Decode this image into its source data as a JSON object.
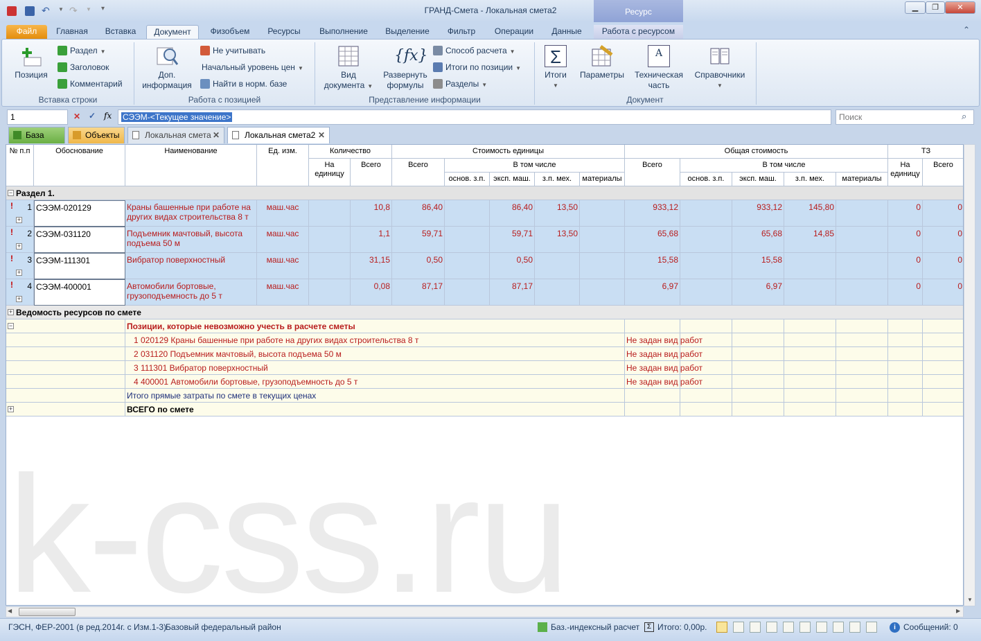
{
  "window": {
    "title": "ГРАНД-Смета - Локальная смета2",
    "context_tab": "Ресурс",
    "buttons": {
      "minimize": "▁",
      "restore": "❐",
      "close": "✕"
    }
  },
  "ribbon_tabs": [
    "Файл",
    "Главная",
    "Вставка",
    "Документ",
    "Физобъем",
    "Ресурсы",
    "Выполнение",
    "Выделение",
    "Фильтр",
    "Операции",
    "Данные",
    "Работа с ресурсом"
  ],
  "ribbon": {
    "groups": {
      "insert_row": "Вставка строки",
      "position_work": "Работа с позицией",
      "info_view": "Представление информации",
      "document": "Документ"
    },
    "insert_row": {
      "position": "Позиция",
      "section": "Раздел",
      "heading": "Заголовок",
      "comment": "Комментарий"
    },
    "position_work": {
      "extra_info_1": "Доп.",
      "extra_info_2": "информация",
      "ignore": "Не учитывать",
      "initial_price_level": "Начальный уровень цен",
      "find_in_base": "Найти в норм. базе"
    },
    "info_view": {
      "view_1": "Вид",
      "view_2": "документа",
      "formulas_1": "Развернуть",
      "formulas_2": "формулы",
      "calc_method": "Способ расчета",
      "position_totals": "Итоги по позиции",
      "sections": "Разделы"
    },
    "document": {
      "totals": "Итоги",
      "parameters": "Параметры",
      "tech_1": "Техническая",
      "tech_2": "часть",
      "refs": "Справочники"
    }
  },
  "formula_bar": {
    "cell_ref": "1",
    "value": "СЭЭМ-<Текущее значение>",
    "search_placeholder": "Поиск"
  },
  "doc_tabs": [
    "База",
    "Объекты",
    "Локальная смета",
    "Локальная смета2"
  ],
  "grid": {
    "headers": {
      "num": "№ п.п",
      "basis": "Обоснование",
      "name": "Наименование",
      "unit": "Ед. изм.",
      "qty": "Количество",
      "qty_per_unit": "На единицу",
      "qty_total": "Всего",
      "unit_cost": "Стоимость единицы",
      "unit_cost_total": "Всего",
      "incl": "В том числе",
      "base_wage": "основ. з.п.",
      "mach_exp": "эксп. маш.",
      "mach_wage": "з.п. мех.",
      "materials": "материалы",
      "total_cost": "Общая стоимость",
      "total_cost_total": "Всего",
      "incl2": "В том числе",
      "base_wage2": "основ. з.п.",
      "mach_exp2": "эксп. маш.",
      "mach_wage2": "з.п. мех.",
      "materials2": "материалы",
      "tz": "ТЗ",
      "tz_per_unit": "На единицу",
      "tz_total": "Всего"
    },
    "section_title": "Раздел 1.",
    "rows": [
      {
        "n": "1",
        "code": "СЭЭМ-020129",
        "name": "Краны башенные при работе на других видах строительства 8 т",
        "unit": "маш.час",
        "qty_total": "10,8",
        "uc_total": "86,40",
        "uc_mach": "86,40",
        "uc_wage": "13,50",
        "tc_total": "933,12",
        "tc_mach": "933,12",
        "tc_wage": "145,80",
        "tz_unit": "0",
        "tz_total": "0"
      },
      {
        "n": "2",
        "code": "СЭЭМ-031120",
        "name": "Подъемник мачтовый, высота подъема 50 м",
        "unit": "маш.час",
        "qty_total": "1,1",
        "uc_total": "59,71",
        "uc_mach": "59,71",
        "uc_wage": "13,50",
        "tc_total": "65,68",
        "tc_mach": "65,68",
        "tc_wage": "14,85",
        "tz_unit": "0",
        "tz_total": "0"
      },
      {
        "n": "3",
        "code": "СЭЭМ-111301",
        "name": "Вибратор поверхностный",
        "unit": "маш.час",
        "qty_total": "31,15",
        "uc_total": "0,50",
        "uc_mach": "0,50",
        "uc_wage": "",
        "tc_total": "15,58",
        "tc_mach": "15,58",
        "tc_wage": "",
        "tz_unit": "0",
        "tz_total": "0"
      },
      {
        "n": "4",
        "code": "СЭЭМ-400001",
        "name": "Автомобили бортовые, грузоподъемность до 5 т",
        "unit": "маш.час",
        "qty_total": "0,08",
        "uc_total": "87,17",
        "uc_mach": "87,17",
        "uc_wage": "",
        "tc_total": "6,97",
        "tc_mach": "6,97",
        "tc_wage": "",
        "tz_unit": "0",
        "tz_total": "0"
      }
    ],
    "resource_sheet": "Ведомость ресурсов по смете",
    "impossible_title": "Позиции, которые невозможно учесть в расчете сметы",
    "impossible": [
      {
        "text": "1 020129 Краны башенные при работе на других видах строительства 8 т",
        "note": "Не задан вид работ"
      },
      {
        "text": "2 031120 Подъемник мачтовый, высота подъема 50 м",
        "note": "Не задан вид работ"
      },
      {
        "text": "3 111301 Вибратор поверхностный",
        "note": "Не задан вид работ"
      },
      {
        "text": "4 400001 Автомобили бортовые, грузоподъемность до 5 т",
        "note": "Не задан вид работ"
      }
    ],
    "direct_costs": "Итого прямые затраты по смете в текущих ценах",
    "total": "ВСЕГО по смете"
  },
  "watermark": "k-css.ru",
  "statusbar": {
    "base": "ГЭСН, ФЕР-2001 (в ред.2014г. с Изм.1-3)",
    "region": "Базовый федеральный район",
    "calc": "Баз.-индексный расчет",
    "total": "Итого: 0,00р.",
    "messages": "Сообщений: 0"
  },
  "colors": {
    "accent": "#e48d0c",
    "row_blue": "#c9def3",
    "text_red": "#b81c1c",
    "row_yellow": "#fdfcea"
  }
}
